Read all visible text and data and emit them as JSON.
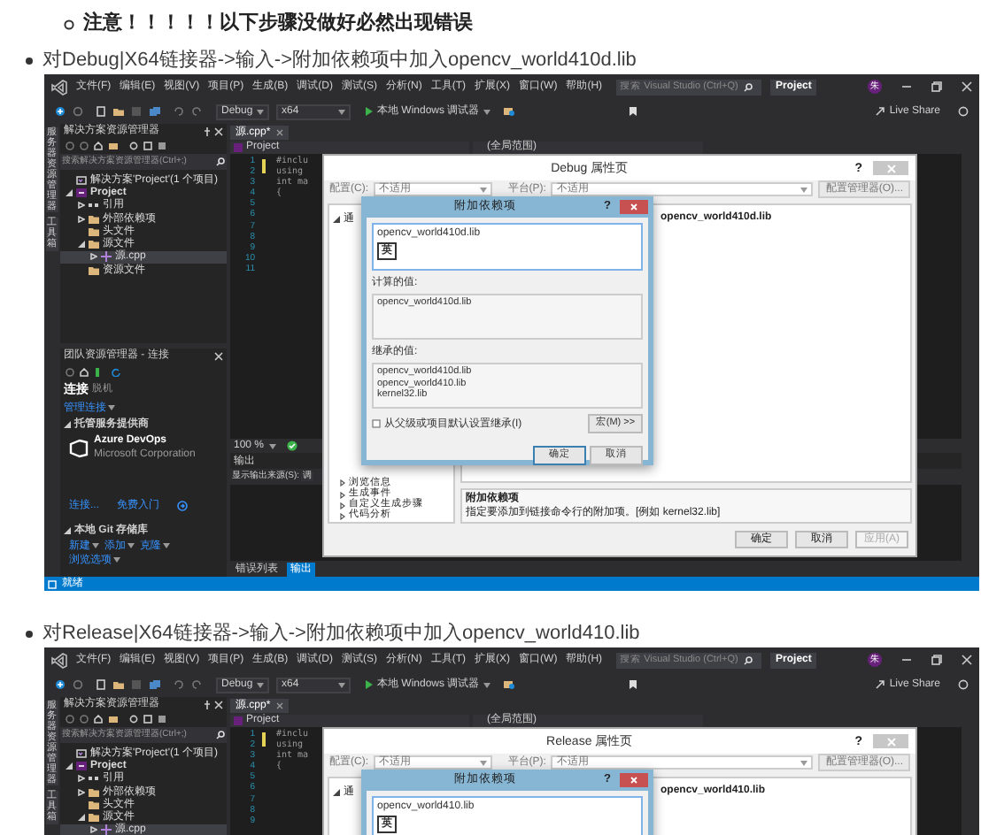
{
  "note": {
    "text": "注意！！！！！以下步骤没做好必然出现错误"
  },
  "steps": [
    {
      "text": "对Debug|X64链接器->输入->附加依赖项中加入opencv_world410d.lib",
      "screenshot": {
        "menu": [
          "文件(F)",
          "编辑(E)",
          "视图(V)",
          "项目(P)",
          "生成(B)",
          "调试(D)",
          "测试(S)",
          "分析(N)",
          "工具(T)",
          "扩展(X)",
          "窗口(W)",
          "帮助(H)"
        ],
        "search_placeholder": "搜索 Visual Studio (Ctrl+Q)",
        "project": "Project",
        "avatar": "朱",
        "toolbar": {
          "configuration": "Debug",
          "platform": "x64",
          "run": "本地 Windows 调试器"
        },
        "live_share": "Live Share",
        "side_tabs": [
          "服务器资源管理器",
          "工具箱"
        ],
        "solution_explorer": {
          "title": "解决方案资源管理器",
          "search_placeholder": "搜索解决方案资源管理器(Ctrl+;)",
          "tree": [
            {
              "kind": "solution",
              "label": "解决方案'Project'(1 个项目)",
              "selected": false,
              "children": [
                {
                  "kind": "project",
                  "label": "Project",
                  "expanded": true,
                  "selected": false,
                  "children": [
                    {
                      "kind": "references",
                      "label": "引用",
                      "expanded": false,
                      "selected": false
                    },
                    {
                      "kind": "external",
                      "label": "外部依赖项",
                      "expanded": false,
                      "selected": false
                    },
                    {
                      "kind": "folder",
                      "label": "头文件",
                      "selected": false
                    },
                    {
                      "kind": "folder",
                      "label": "源文件",
                      "expanded": true,
                      "selected": false,
                      "children": [
                        {
                          "kind": "file",
                          "label": "源.cpp",
                          "expanded": false,
                          "selected": true
                        }
                      ]
                    },
                    {
                      "kind": "folder",
                      "label": "资源文件",
                      "selected": false
                    }
                  ]
                }
              ]
            }
          ]
        },
        "team_explorer": {
          "title": "团队资源管理器 - 连接",
          "tabs": [
            {
              "label": "连接",
              "selected": true
            },
            {
              "label": "脱机",
              "selected": false
            }
          ],
          "manage": "管理连接",
          "hosted_title": "托管服务提供商",
          "provider": "Azure DevOps",
          "company": "Microsoft Corporation",
          "provider_links": [
            "连接...",
            "免费入门"
          ],
          "git_title": "本地 Git 存储库",
          "git_links": [
            "新建",
            "添加",
            "克隆"
          ],
          "browse": "浏览选项"
        },
        "editor": {
          "tab": "源.cpp*",
          "nav_project": "Project",
          "nav_scope": "(全局范围)",
          "line_numbers": [
            "1",
            "2",
            "3",
            "4",
            "5",
            "6",
            "7",
            "8",
            "9",
            "10",
            "11"
          ],
          "code": [
            "#inclu",
            "using",
            "int ma",
            "{"
          ]
        },
        "output": {
          "zoom": "100 %",
          "title": "输出",
          "source_label": "显示输出来源(S):",
          "source": "调",
          "tabs": [
            {
              "label": "错误列表",
              "selected": false
            },
            {
              "label": "输出",
              "selected": true
            }
          ]
        },
        "status": "就绪",
        "property_dialog": {
          "title": "Debug 属性页",
          "help": "?",
          "config_label": "配置(C):",
          "config_value": "不适用",
          "platform_label": "平台(P):",
          "platform_value": "不适用",
          "config_manager": "配置管理器(O)...",
          "tree_top": "通",
          "tree_items": [
            "浏览信息",
            "生成事件",
            "自定义生成步骤",
            "代码分析"
          ],
          "value": "opencv_world410d.lib",
          "description_title": "附加依赖项",
          "description": "指定要添加到链接命令行的附加项。[例如 kernel32.lib]",
          "buttons": [
            {
              "label": "确定",
              "disabled": false
            },
            {
              "label": "取消",
              "disabled": false
            },
            {
              "label": "应用(A)",
              "disabled": true
            }
          ]
        },
        "deps_dialog": {
          "title": "附加依赖项",
          "help": "?",
          "value": "opencv_world410d.lib",
          "ime": "英",
          "computed_label": "计算的值:",
          "computed": [
            "opencv_world410d.lib"
          ],
          "inherited_label": "继承的值:",
          "inherited": [
            "opencv_world410d.lib",
            "opencv_world410.lib",
            "kernel32.lib"
          ],
          "inherit_checkbox": {
            "label": "从父级或项目默认设置继承(I)",
            "checked": false
          },
          "macro_button": "宏(M) >>",
          "buttons": [
            "确定",
            "取消"
          ]
        }
      }
    },
    {
      "text": "对Release|X64链接器->输入->附加依赖项中加入opencv_world410.lib",
      "screenshot": {
        "menu": [
          "文件(F)",
          "编辑(E)",
          "视图(V)",
          "项目(P)",
          "生成(B)",
          "调试(D)",
          "测试(S)",
          "分析(N)",
          "工具(T)",
          "扩展(X)",
          "窗口(W)",
          "帮助(H)"
        ],
        "search_placeholder": "搜索 Visual Studio (Ctrl+Q)",
        "project": "Project",
        "avatar": "朱",
        "toolbar": {
          "configuration": "Debug",
          "platform": "x64",
          "run": "本地 Windows 调试器"
        },
        "live_share": "Live Share",
        "side_tabs": [
          "服务器资源管理器",
          "工具箱"
        ],
        "solution_explorer": {
          "title": "解决方案资源管理器",
          "search_placeholder": "搜索解决方案资源管理器(Ctrl+;)",
          "tree": [
            {
              "kind": "solution",
              "label": "解决方案'Project'(1 个项目)",
              "selected": false,
              "children": [
                {
                  "kind": "project",
                  "label": "Project",
                  "expanded": true,
                  "selected": false,
                  "children": [
                    {
                      "kind": "references",
                      "label": "引用",
                      "expanded": false,
                      "selected": false
                    },
                    {
                      "kind": "external",
                      "label": "外部依赖项",
                      "expanded": false,
                      "selected": false
                    },
                    {
                      "kind": "folder",
                      "label": "头文件",
                      "selected": false
                    },
                    {
                      "kind": "folder",
                      "label": "源文件",
                      "expanded": true,
                      "selected": false,
                      "children": [
                        {
                          "kind": "file",
                          "label": "源.cpp",
                          "expanded": false,
                          "selected": true
                        }
                      ]
                    }
                  ]
                }
              ]
            }
          ]
        },
        "editor": {
          "tab": "源.cpp*",
          "nav_project": "Project",
          "nav_scope": "(全局范围)",
          "line_numbers": [
            "1",
            "2",
            "3",
            "4",
            "5",
            "6",
            "7",
            "8",
            "9"
          ],
          "code": [
            "#inclu",
            "using",
            "int ma",
            "{"
          ]
        },
        "property_dialog": {
          "title": "Release 属性页",
          "help": "?",
          "config_label": "配置(C):",
          "config_value": "不适用",
          "platform_label": "平台(P):",
          "platform_value": "不适用",
          "config_manager": "配置管理器(O)...",
          "tree_top": "通",
          "value": "opencv_world410.lib"
        },
        "deps_dialog": {
          "title": "附加依赖项",
          "help": "?",
          "value": "opencv_world410.lib",
          "ime": "英"
        }
      }
    }
  ]
}
